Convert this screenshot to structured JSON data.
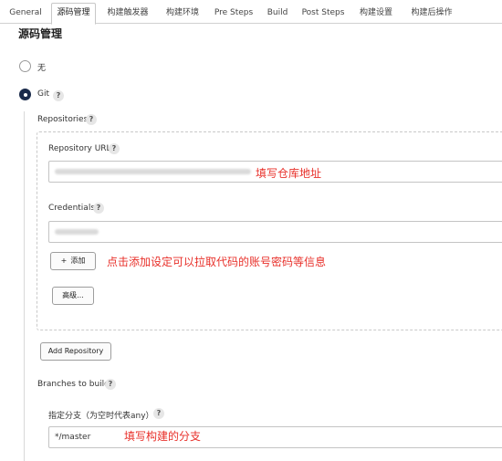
{
  "tabs": [
    {
      "label": "General"
    },
    {
      "label": "源码管理",
      "active": true
    },
    {
      "label": "构建触发器"
    },
    {
      "label": "构建环境"
    },
    {
      "label": "Pre Steps"
    },
    {
      "label": "Build"
    },
    {
      "label": "Post Steps"
    },
    {
      "label": "构建设置"
    },
    {
      "label": "构建后操作"
    }
  ],
  "scm": {
    "title": "源码管理",
    "option_none": "无",
    "option_git": "Git",
    "selected": "Git"
  },
  "repositories": {
    "label": "Repositories",
    "url_label": "Repository URL",
    "credentials_label": "Credentials",
    "add_button": "添加",
    "add_icon": "+",
    "advanced_button": "高级...",
    "add_repo_button": "Add Repository"
  },
  "branches": {
    "label": "Branches to build",
    "spec_label": "指定分支（为空时代表any）",
    "spec_value": "*/master"
  },
  "help_glyph": "?",
  "annotations": {
    "repo_url_note": "填写仓库地址",
    "credentials_note": "点击添加设定可以拉取代码的账号密码等信息",
    "branch_note": "填写构建的分支"
  },
  "colors": {
    "annotation": "#e8302a",
    "radio_checked": "#1a2a4a"
  }
}
